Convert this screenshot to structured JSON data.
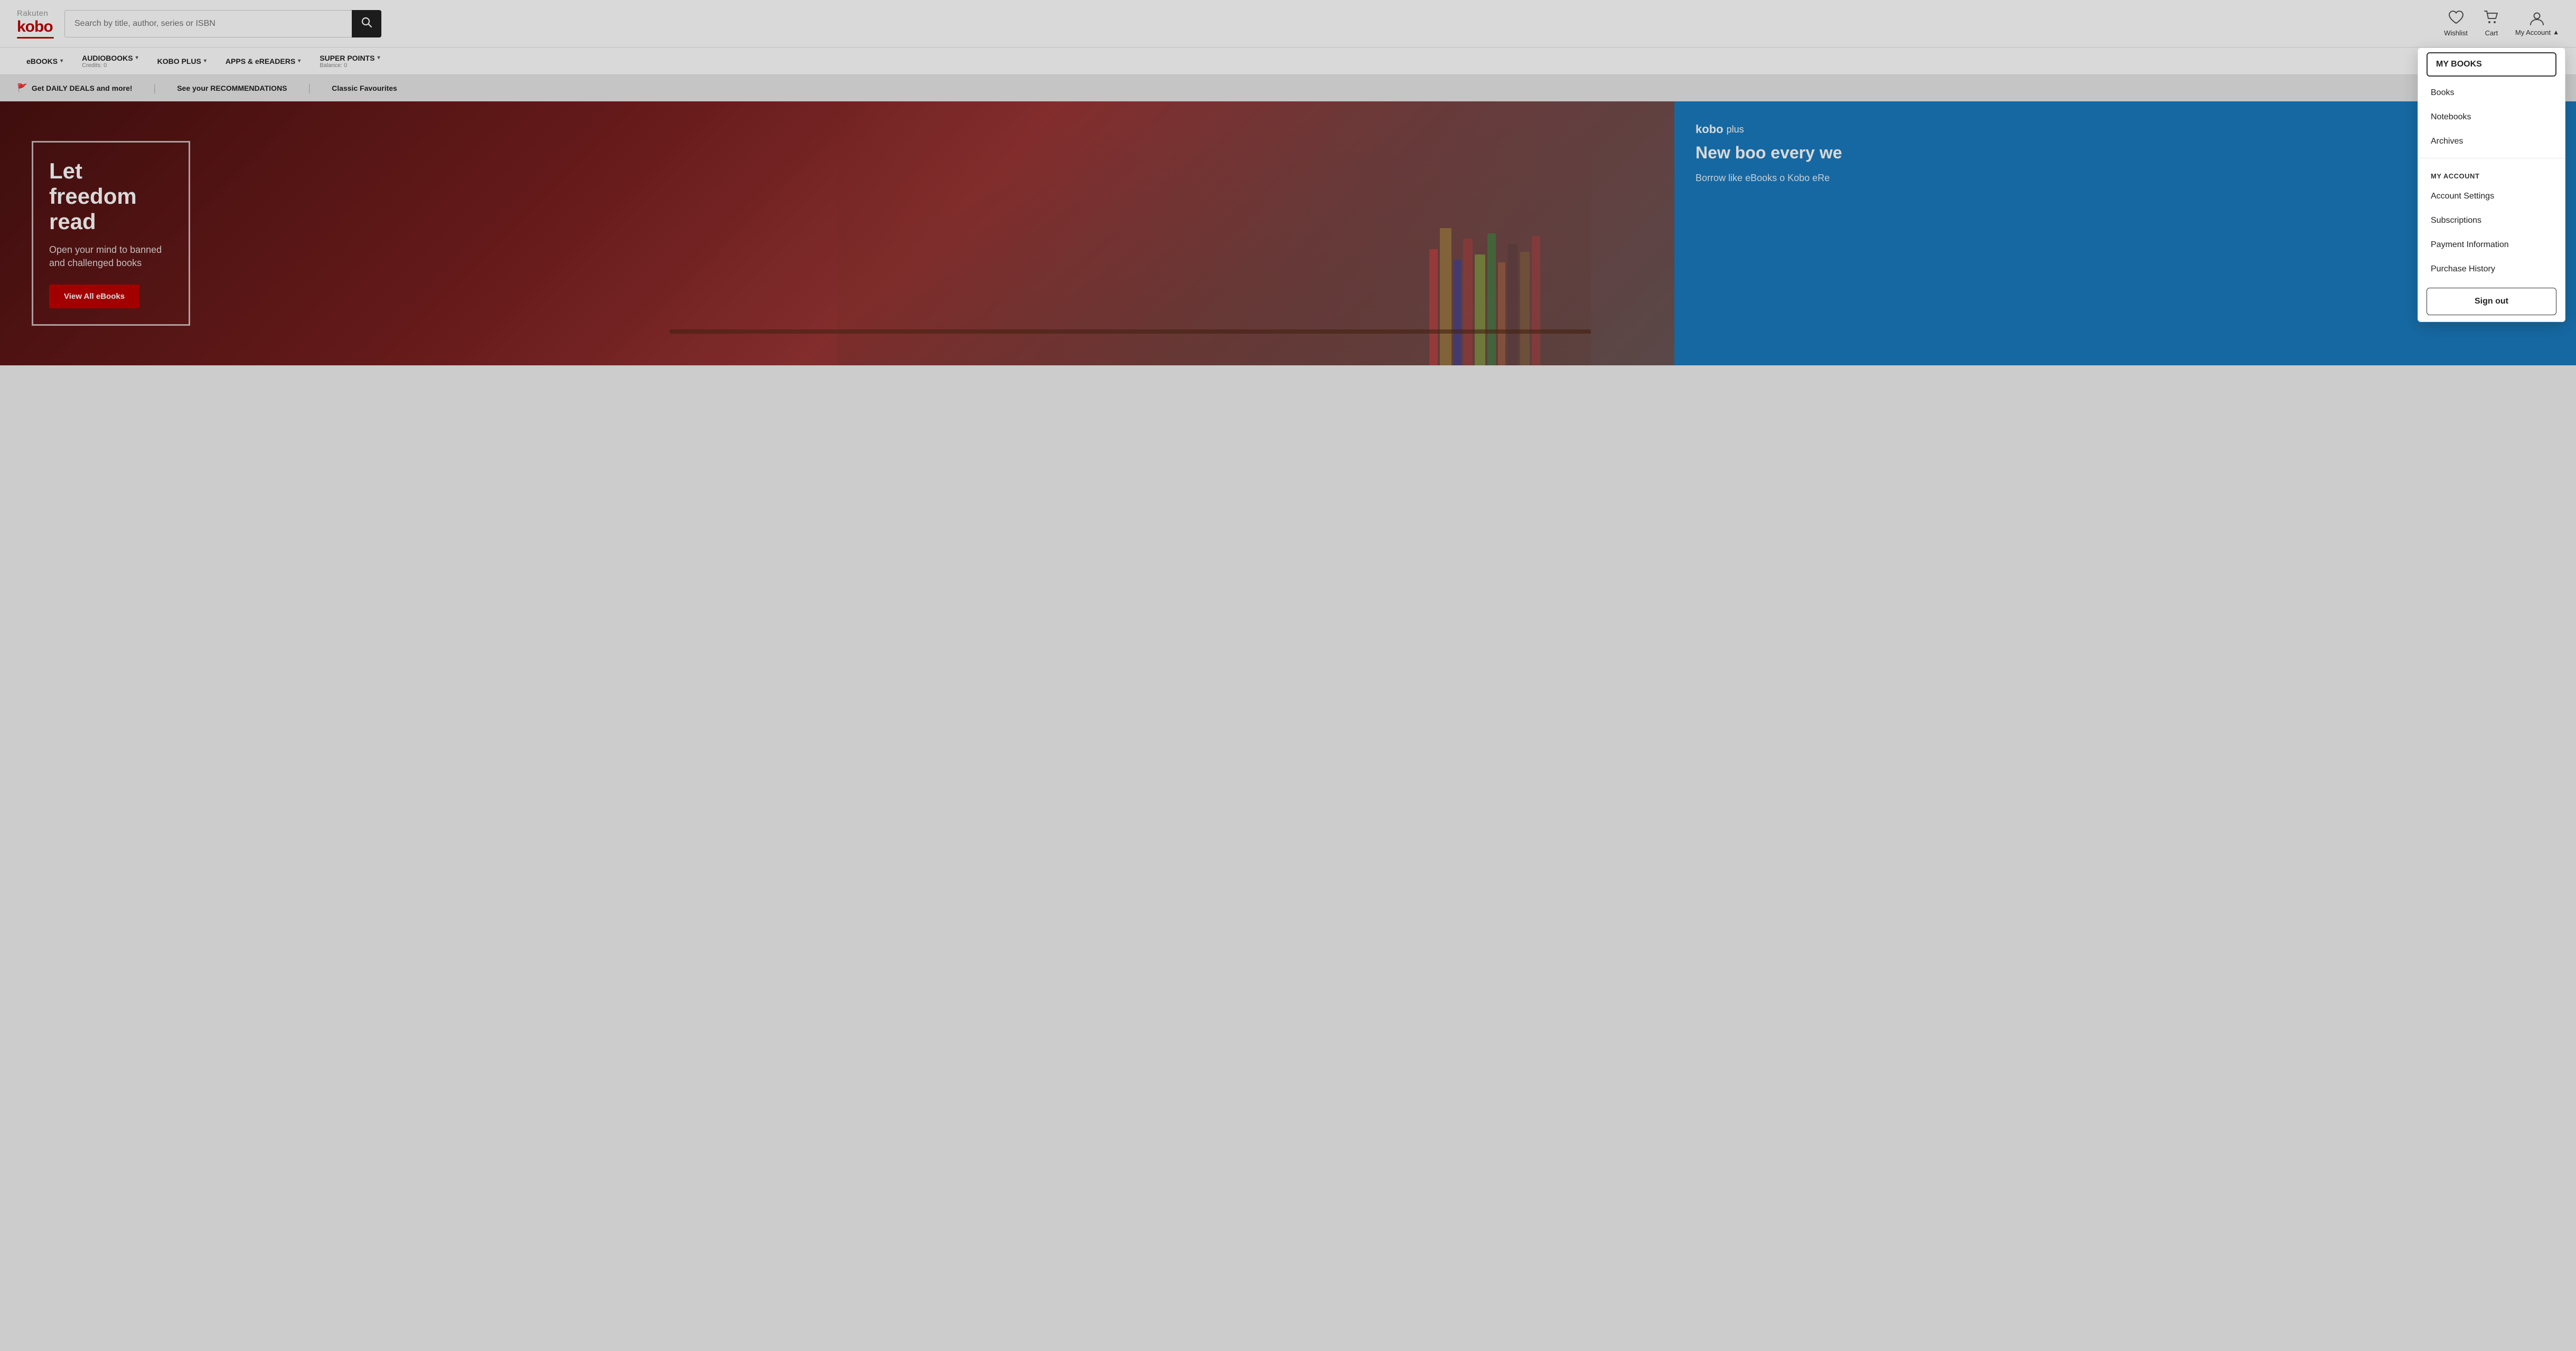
{
  "header": {
    "logo": "Rakuten kobo",
    "search_placeholder": "Search by title, author, series or ISBN",
    "wishlist_label": "Wishlist",
    "cart_label": "Cart",
    "my_account_label": "My Account"
  },
  "nav": {
    "items": [
      {
        "label": "eBOOKS",
        "sub": ""
      },
      {
        "label": "AUDIOBOOKS",
        "sub": "Credits: 0"
      },
      {
        "label": "KOBO PLUS",
        "sub": ""
      },
      {
        "label": "APPS & eREADERS",
        "sub": ""
      },
      {
        "label": "SUPER POINTS",
        "sub": "Balance: 0"
      }
    ]
  },
  "promo_bar": {
    "items": [
      {
        "icon": "🚩",
        "text": "Get DAILY DEALS and more!"
      },
      {
        "text": "See your RECOMMENDATIONS"
      },
      {
        "text": "Classic Favourites"
      }
    ]
  },
  "hero": {
    "title": "Let freedom read",
    "subtitle": "Open your mind to banned and challenged books",
    "button_label": "View All eBooks"
  },
  "right_panel": {
    "badge_kobo": "kobo",
    "badge_plus": "plus",
    "title": "New boo every we",
    "subtitle": "Borrow like\neBooks o\nKobo eRe"
  },
  "dropdown": {
    "my_books_section": "MY BOOKS",
    "books_label": "Books",
    "notebooks_label": "Notebooks",
    "archives_label": "Archives",
    "my_account_section": "MY ACCOUNT",
    "account_settings_label": "Account Settings",
    "subscriptions_label": "Subscriptions",
    "payment_info_label": "Payment Information",
    "purchase_history_label": "Purchase History",
    "sign_out_label": "Sign out",
    "my_books_active": "MY BOOKS"
  }
}
